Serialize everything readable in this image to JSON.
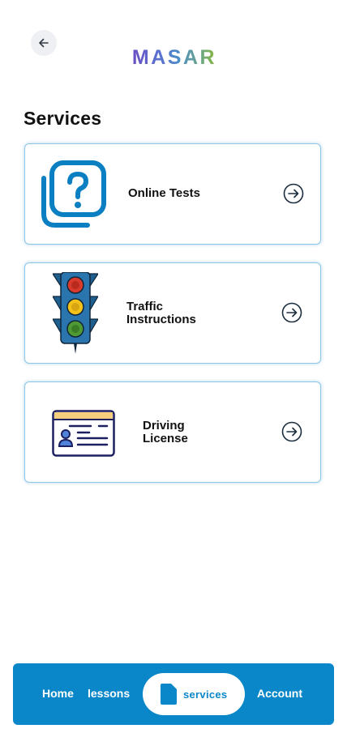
{
  "brand": {
    "logo_text": "MASAR",
    "logo_colors": [
      "#6a4fc4",
      "#5b6fd0",
      "#4c8bc7",
      "#6aa58a",
      "#8ab83a"
    ]
  },
  "header": {
    "back_icon": "arrow-left-icon"
  },
  "main": {
    "title": "Services",
    "cards": [
      {
        "label_lines": [
          "Online Tests"
        ],
        "icon": "question-chat-icon",
        "arrow_icon": "arrow-right-circle-icon"
      },
      {
        "label_lines": [
          "Traffic",
          "Instructions"
        ],
        "icon": "traffic-light-icon",
        "arrow_icon": "arrow-right-circle-icon"
      },
      {
        "label_lines": [
          "Driving",
          "License"
        ],
        "icon": "id-card-icon",
        "arrow_icon": "arrow-right-circle-icon"
      }
    ]
  },
  "bottom_nav": {
    "items": {
      "home": "Home",
      "lessons": "lessons",
      "services": "services",
      "account": "Account"
    },
    "active": "services",
    "colors": {
      "bar": "#0987c9",
      "active_pill": "#ffffff"
    }
  }
}
